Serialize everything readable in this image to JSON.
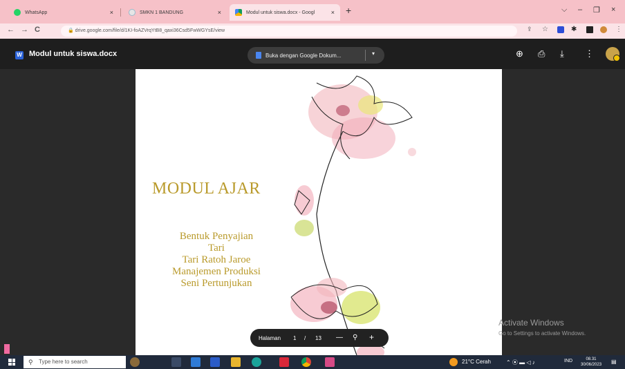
{
  "browser": {
    "tabs": [
      {
        "label": "WhatsApp",
        "icon": "whatsapp-icon",
        "close": "×"
      },
      {
        "label": "SMKN 1 BANDUNG",
        "icon": "school-icon",
        "close": "×"
      },
      {
        "label": "Modul untuk siswa.docx - Googl",
        "icon": "google-drive-icon",
        "close": "×"
      }
    ],
    "new_tab": "+",
    "window_controls": [
      "⌵",
      "–",
      "❐",
      "×"
    ],
    "url": "drive.google.com/file/d/1KI-foAZVrqYtB8_qaxi36Csd5FwWGYsE/view"
  },
  "viewer": {
    "doc_title": "Modul untuk siswa.docx",
    "doc_badge": "W",
    "open_with": "Buka dengan Google Dokum...",
    "open_with_caret": "▾"
  },
  "document": {
    "heading": "MODUL AJAR",
    "lines": [
      "Bentuk Penyajian",
      "Tari",
      "Tari Ratoh Jaroe",
      "Manajemen Produksi",
      "Seni Pertunjukan"
    ]
  },
  "page_controls": {
    "label": "Halaman",
    "current": "1",
    "separator": "/",
    "total": "13",
    "zoom_out": "—",
    "zoom_in": "+"
  },
  "watermark": {
    "line1": "Activate Windows",
    "line2": "Go to Settings to activate Windows."
  },
  "taskbar": {
    "search_placeholder": "Type here to search",
    "weather": "21°C  Cerah",
    "lang": "IND",
    "time": "08.31",
    "date": "30/06/2023"
  },
  "colors": {
    "tabbar": "#f6c1c8",
    "heading_gold": "#b99a2b",
    "viewer_bg": "#2a2a2a"
  }
}
